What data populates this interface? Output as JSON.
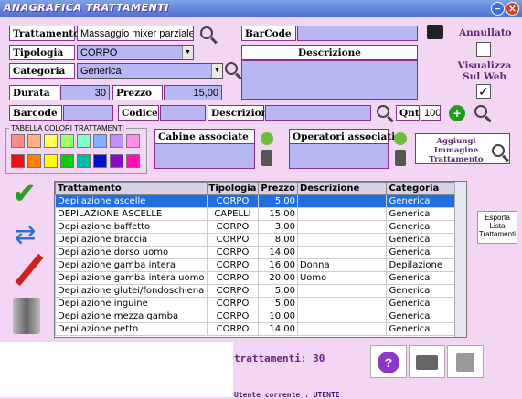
{
  "window": {
    "title": "ANAGRAFICA TRATTAMENTI",
    "minimize_icon": "minus-icon",
    "close_icon": "close-icon"
  },
  "form": {
    "trattamento_label": "Trattamento",
    "trattamento_value": "Massaggio mixer parziale",
    "tipologia_label": "Tipologia",
    "tipologia_value": "CORPO",
    "categoria_label": "Categoria",
    "categoria_value": "Generica",
    "durata_label": "Durata",
    "durata_value": "30",
    "prezzo_label": "Prezzo",
    "prezzo_value": "15,00",
    "barcode_label": "BarCode",
    "descrizione_label": "Descrizione",
    "annullato_label": "Annullato",
    "visualizza_label": "Visualizza Sul Web",
    "annullato_checked": false,
    "visualizza_checked": true
  },
  "search_row": {
    "barcode_label": "Barcode",
    "codice_label": "Codice",
    "descrizione_label": "Descrizione",
    "qnt_label": "Qnt",
    "qnt_value": "100"
  },
  "colors": {
    "title": "TABELLA COLORI TRATTAMENTI",
    "swatches": [
      "#ff8a8a",
      "#ffb080",
      "#ffff60",
      "#a0ff70",
      "#80ffcc",
      "#80b0ff",
      "#c090ff",
      "#ff90e8",
      "#ee1010",
      "#ff8000",
      "#ffff00",
      "#10cc10",
      "#00bbaa",
      "#0010cc",
      "#8010c0",
      "#ff10b0"
    ]
  },
  "cabine": {
    "label": "Cabine associate"
  },
  "operatori": {
    "label": "Operatori associati"
  },
  "immagine": {
    "label": "Aggiungi Immagine Trattamento"
  },
  "grid": {
    "columns": [
      "Trattamento",
      "Tipologia",
      "Prezzo",
      "Descrizione",
      "Categoria"
    ],
    "rows": [
      [
        "Depilazione ascelle",
        "CORPO",
        "5,00",
        "",
        "Generica"
      ],
      [
        "DEPILAZIONE ASCELLE",
        "CAPELLI",
        "15,00",
        "",
        "Generica"
      ],
      [
        "Depilazione baffetto",
        "CORPO",
        "3,00",
        "",
        "Generica"
      ],
      [
        "Depilazione braccia",
        "CORPO",
        "8,00",
        "",
        "Generica"
      ],
      [
        "Depilazione dorso uomo",
        "CORPO",
        "14,00",
        "",
        "Generica"
      ],
      [
        "Depilazione gamba intera",
        "CORPO",
        "16,00",
        "Donna",
        "Depilazione"
      ],
      [
        "Depilazione gamba intera uomo",
        "CORPO",
        "20,00",
        "Uomo",
        "Generica"
      ],
      [
        "Depilazione glutei/fondoschiena",
        "CORPO",
        "5,00",
        "",
        "Generica"
      ],
      [
        "Depilazione inguine",
        "CORPO",
        "5,00",
        "",
        "Generica"
      ],
      [
        "Depilazione mezza gamba",
        "CORPO",
        "10,00",
        "",
        "Generica"
      ],
      [
        "Depilazione petto",
        "CORPO",
        "14,00",
        "",
        "Generica"
      ]
    ]
  },
  "export": {
    "label": "Esporta Lista Trattamenti"
  },
  "status": {
    "count_label": "trattamenti: 30",
    "user_label": "Utente corrente : UTENTE"
  }
}
